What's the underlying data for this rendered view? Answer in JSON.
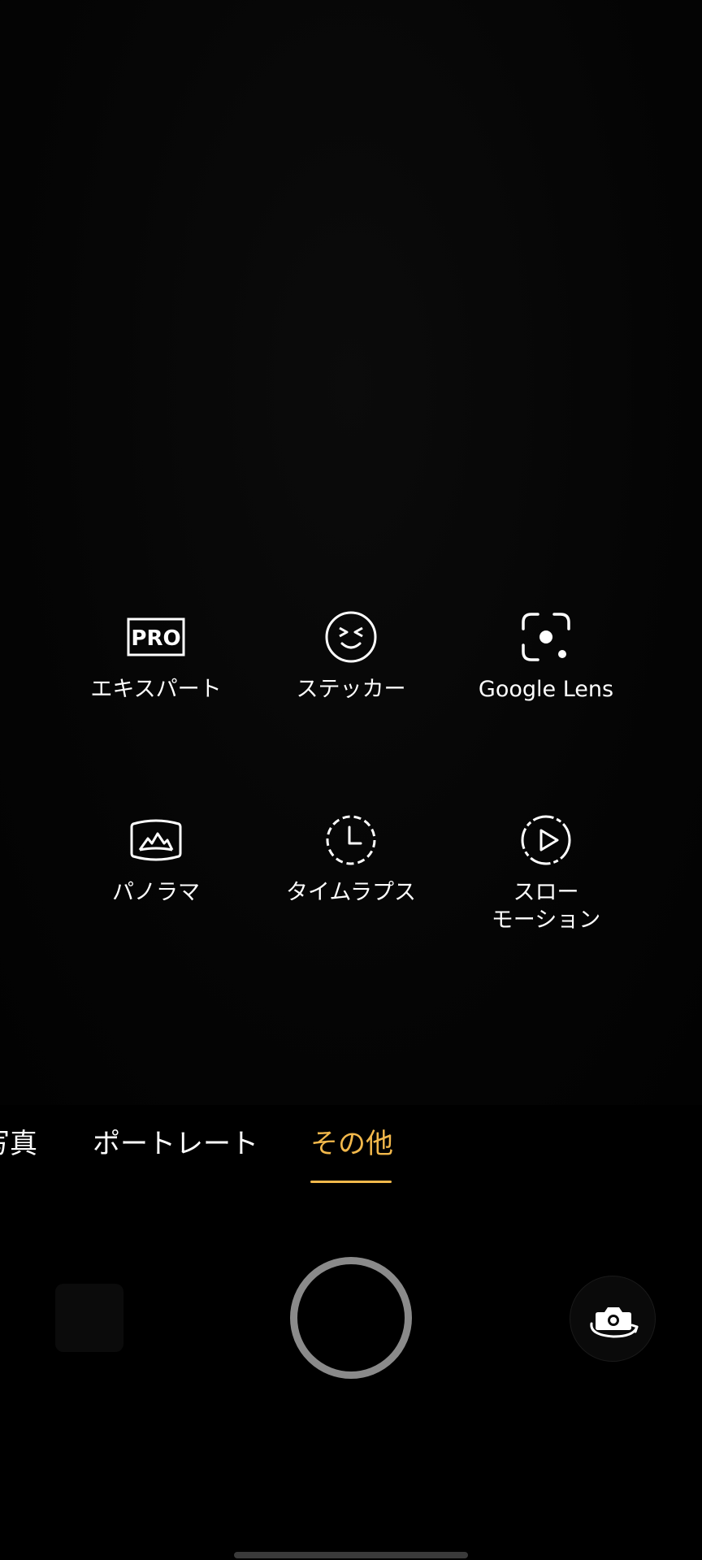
{
  "modes": {
    "expert": {
      "label": "エキスパート",
      "icon_text": "PRO",
      "icon": "pro-icon"
    },
    "sticker": {
      "label": "ステッカー",
      "icon": "sticker-face-icon"
    },
    "lens": {
      "label": "Google Lens",
      "icon": "google-lens-icon"
    },
    "panorama": {
      "label": "パノラマ",
      "icon": "panorama-icon"
    },
    "timelapse": {
      "label": "タイムラプス",
      "icon": "timelapse-clock-icon"
    },
    "slowmo": {
      "label": "スロー\nモーション",
      "icon": "slow-motion-play-icon"
    }
  },
  "tabs": {
    "photo": "写真",
    "portrait": "ポートレート",
    "other": "その他",
    "active": "other"
  },
  "colors": {
    "accent": "#f2b84b",
    "shutter_ring": "#8a8a8a",
    "background": "#000000"
  }
}
